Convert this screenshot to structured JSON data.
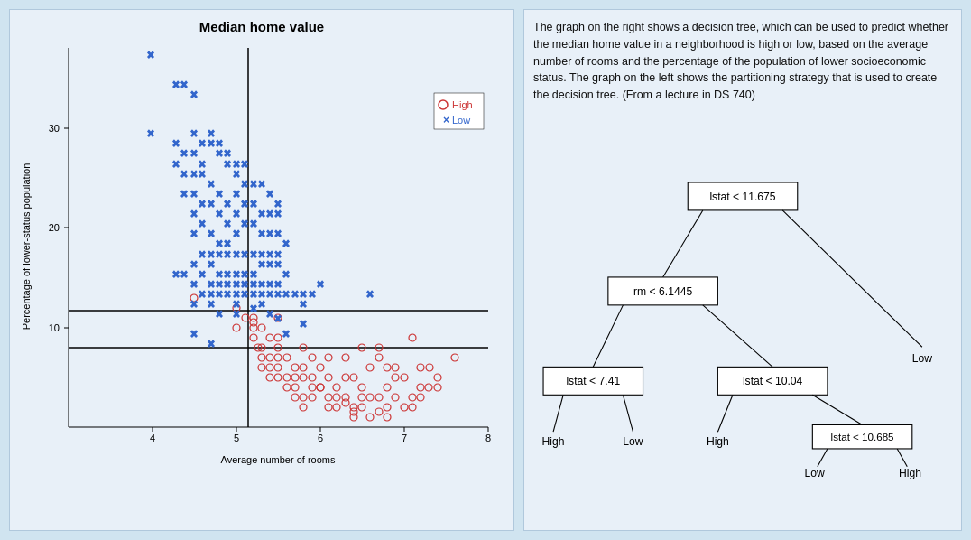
{
  "chart": {
    "title": "Median home value",
    "x_label": "Average number of rooms",
    "y_label": "Percentage of lower-status population",
    "legend": {
      "high_label": "High",
      "low_label": "Low"
    },
    "x_ticks": [
      "4",
      "5",
      "6",
      "7",
      "8"
    ],
    "y_ticks": [
      "10",
      "20",
      "30"
    ]
  },
  "description": "The graph on the right shows a decision tree, which can be used to predict whether the median home value in a neighborhood is high or low, based on the average number of rooms and the percentage of the population of lower socioeconomic status.  The graph on the left shows the partitioning strategy that is used to create the decision tree.  (From a lecture in DS 740)",
  "tree": {
    "root_label": "lstat < 11.675",
    "left_child": {
      "label": "rm < 6.1445",
      "left_child": {
        "label": "lstat < 7.41",
        "left_leaf": "High",
        "right_leaf": "Low"
      },
      "right_child": {
        "label": "lstat < 10.04",
        "right_child": {
          "label": "lstat < 10.685",
          "left_leaf": "Low",
          "right_leaf": "High"
        },
        "left_leaf": "High"
      }
    },
    "right_leaf": "Low"
  }
}
